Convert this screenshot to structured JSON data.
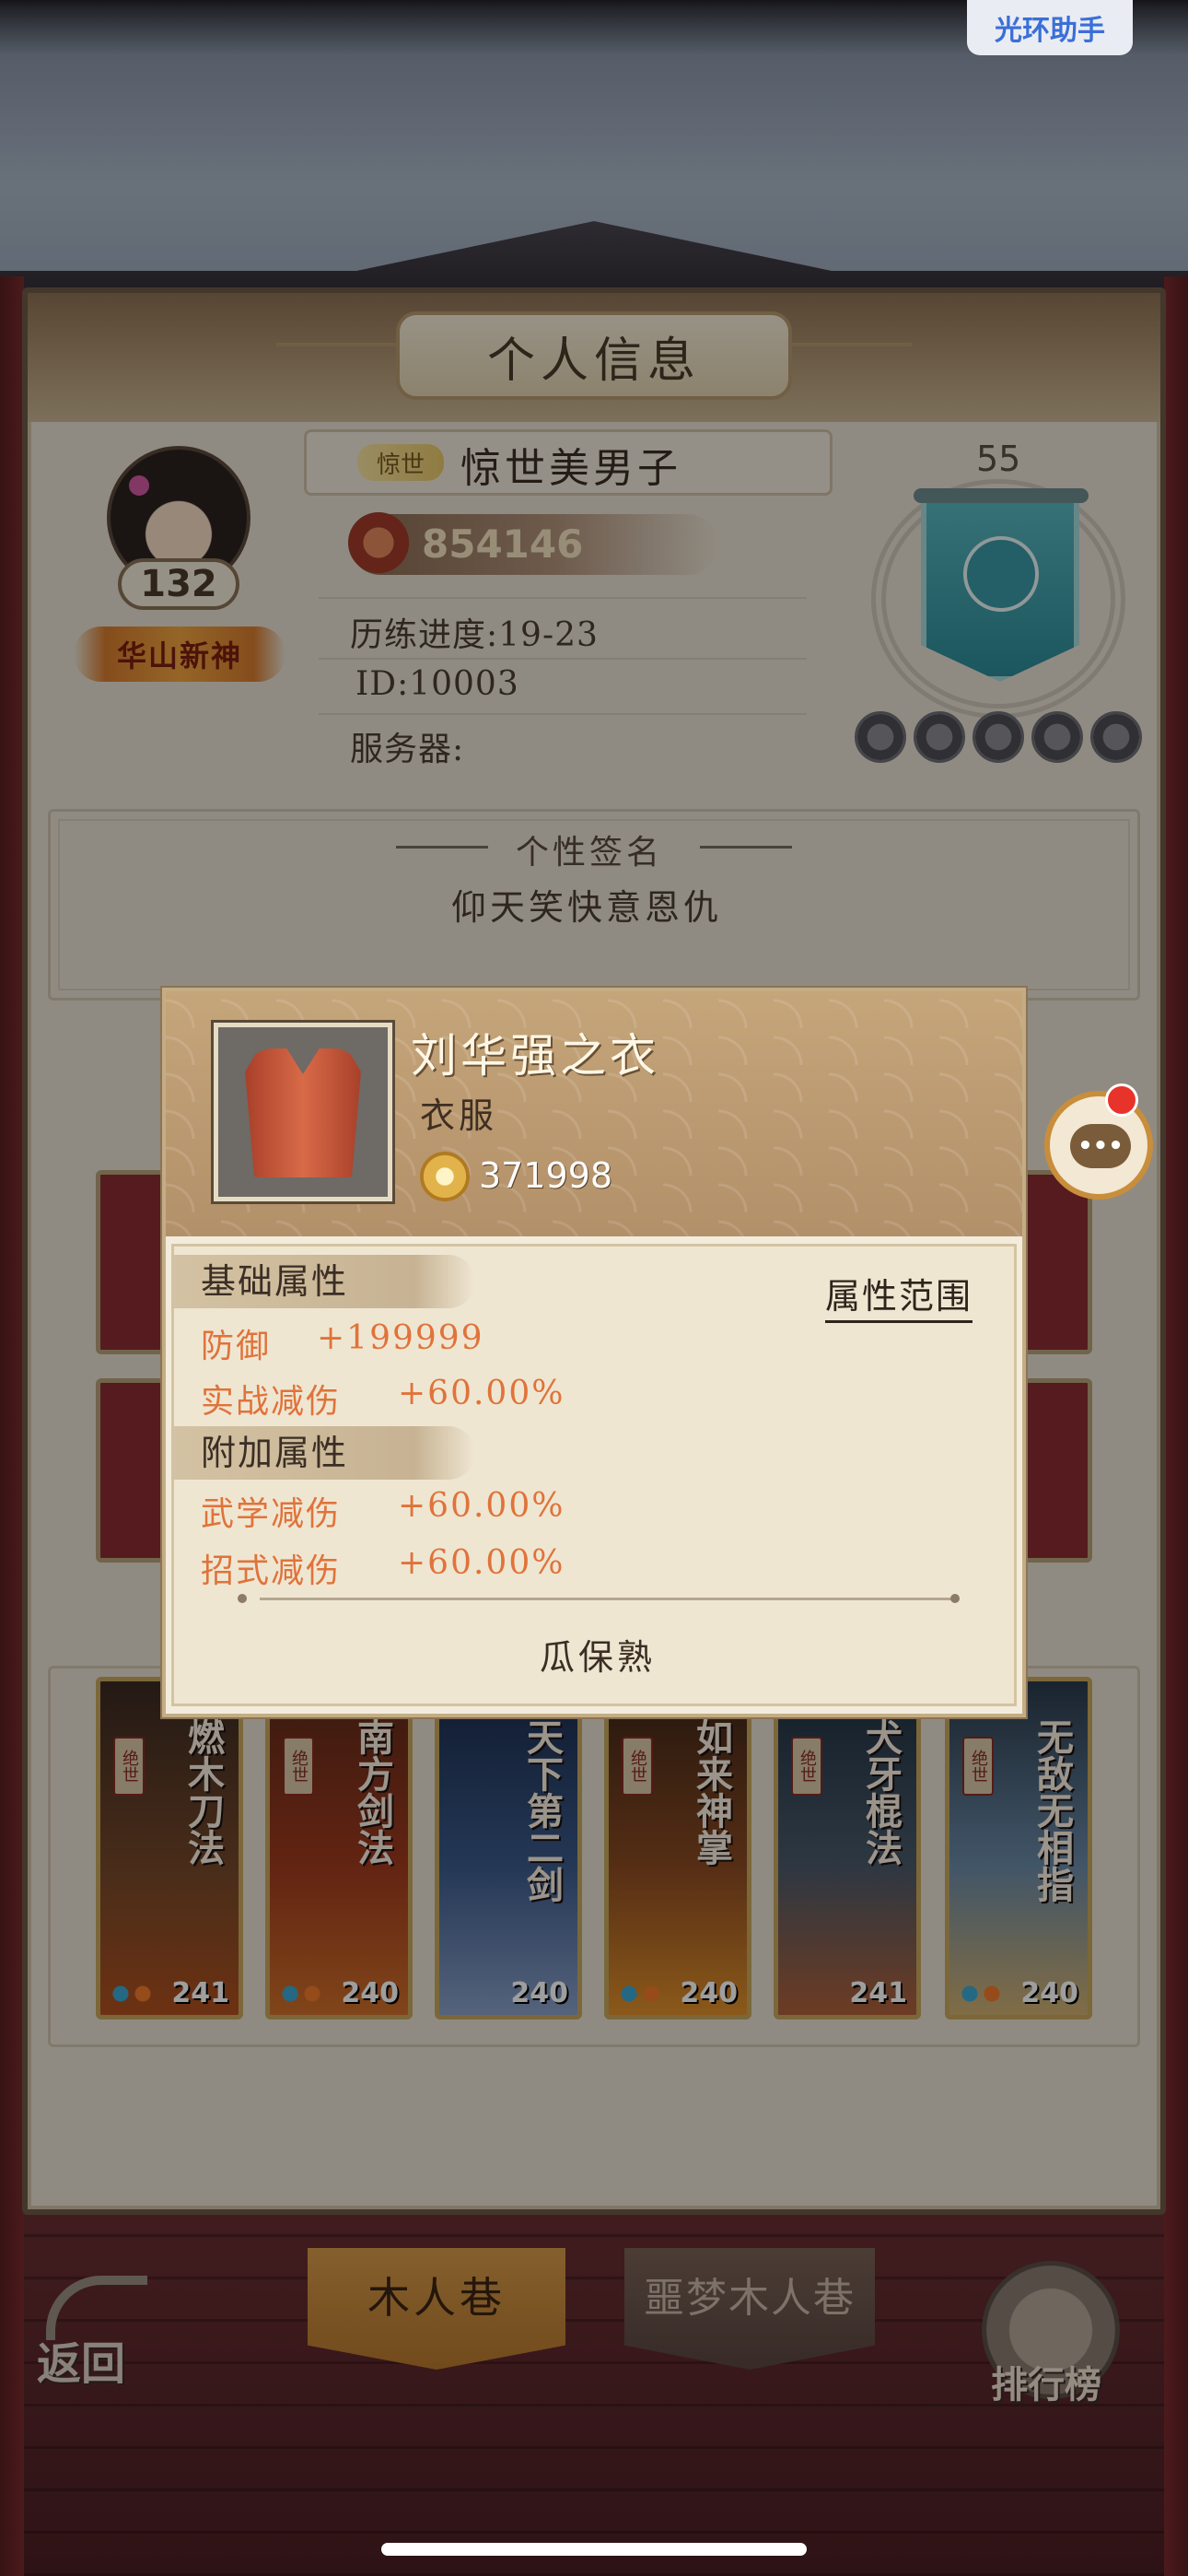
{
  "system": {
    "helper_button": "光环助手"
  },
  "panel": {
    "title": "个人信息"
  },
  "profile": {
    "avatar_level": "132",
    "title_ribbon": "华山新神",
    "name_tag": "惊世",
    "player_name": "惊世美男子",
    "power": "854146",
    "progress_text": "历练进度:19-23",
    "id_text": "ID:10003",
    "server_text": "服务器:",
    "banner_level": "55"
  },
  "signature": {
    "title": "个性签名",
    "text": "仰天笑快意恩仇"
  },
  "skill_cards": [
    {
      "name": "燃木刀法",
      "level": "241"
    },
    {
      "name": "南方剑法",
      "level": "240"
    },
    {
      "name": "天下第二剑",
      "level": "240"
    },
    {
      "name": "如来神掌",
      "level": "240"
    },
    {
      "name": "犬牙棍法",
      "level": "241"
    },
    {
      "name": "无敌无相指",
      "level": "240"
    }
  ],
  "card_tag": "绝世",
  "item_popup": {
    "name": "刘华强之衣",
    "type": "衣服",
    "power": "371998",
    "base_section": "基础属性",
    "range_button": "属性范围",
    "base_attrs": [
      {
        "label": "防御",
        "value": "+199999"
      },
      {
        "label": "实战减伤",
        "value": "+60.00%"
      }
    ],
    "extra_section": "附加属性",
    "extra_attrs": [
      {
        "label": "武学减伤",
        "value": "+60.00%"
      },
      {
        "label": "招式减伤",
        "value": "+60.00%"
      }
    ],
    "source": "瓜保熟"
  },
  "chat": {
    "icon": "chat-bubble-icon",
    "badge_color": "#e8332b"
  },
  "bottom_bar": {
    "back_label": "返回",
    "tab_1": "木人巷",
    "tab_2": "噩梦木人巷",
    "rank_label": "排行榜"
  },
  "colors": {
    "attr_text": "#e0733a",
    "panel_bg": "#e9e1d2",
    "accent_gold": "#c88e3b"
  }
}
